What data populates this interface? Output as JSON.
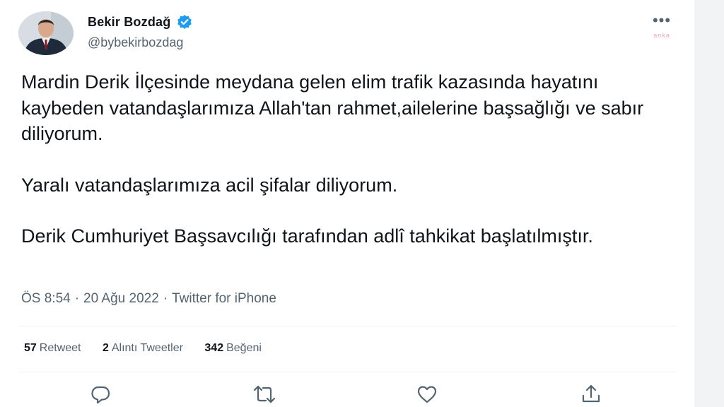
{
  "tweet": {
    "author": {
      "display_name": "Bekir Bozdağ",
      "handle": "@bybekirbozdag",
      "verified": true
    },
    "watermark": "anka",
    "paragraphs": [
      "Mardin Derik İlçesinde meydana gelen elim trafik kazasında hayatını kaybeden vatandaşlarımıza Allah'tan rahmet,ailelerine başsağlığı ve sabır diliyorum.",
      "Yaralı vatandaşlarımıza acil şifalar diliyorum.",
      "Derik Cumhuriyet Başsavcılığı tarafından adlî tahkikat başlatılmıştır."
    ],
    "meta": {
      "time": "ÖS 8:54",
      "separator": "·",
      "date": "20 Ağu 2022",
      "source": "Twitter for iPhone"
    },
    "stats": {
      "retweets": {
        "count": "57",
        "label": "Retweet"
      },
      "quotes": {
        "count": "2",
        "label": "Alıntı Tweetler"
      },
      "likes": {
        "count": "342",
        "label": "Beğeni"
      }
    },
    "actions": [
      "reply-icon",
      "retweet-icon",
      "like-icon",
      "share-icon"
    ]
  },
  "colors": {
    "text_primary": "#0f1419",
    "text_secondary": "#536471",
    "verified_badge": "#1d9bf0",
    "divider": "#eff3f4",
    "watermark": "#f4a7b9"
  }
}
